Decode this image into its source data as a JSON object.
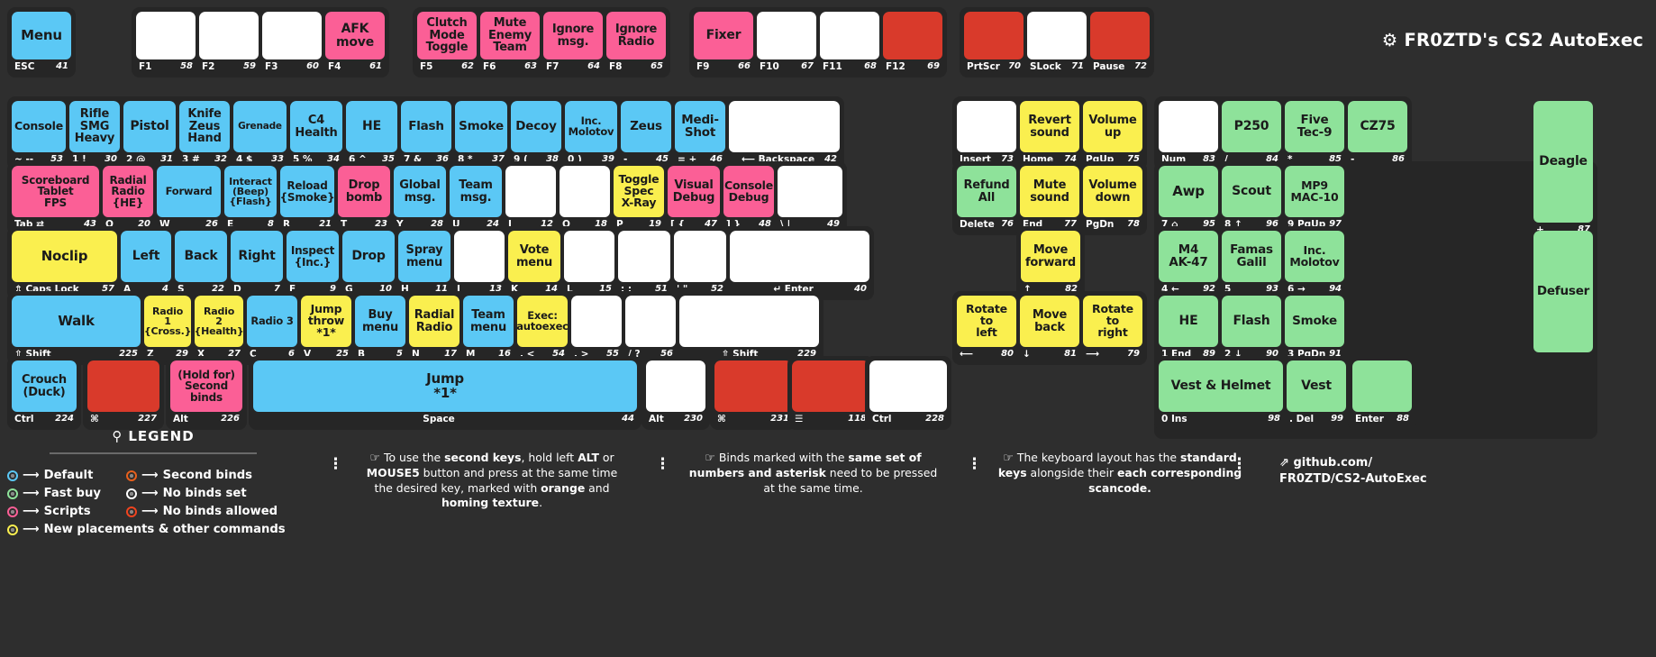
{
  "title": {
    "text": "FR0ZTD's CS2 AutoExec",
    "icon": "gear-icon"
  },
  "colors": {
    "background": "#2e2e2e",
    "block": "#262626",
    "default_blue": "#5bc8f5",
    "fast_buy_green": "#8ee29a",
    "scripts_pink": "#fb5f96",
    "second_binds_orange": "#e8601c",
    "no_binds_set_white": "#ffffff",
    "no_binds_allowed_red": "#d93a2b",
    "new_placements_yellow": "#faef4f"
  },
  "rows": {
    "function_row": [
      {
        "block": "esc",
        "keys": [
          {
            "cap": "Menu",
            "color": "c-blue",
            "name": "ESC",
            "sc": "41",
            "capsize": 15
          }
        ]
      },
      {
        "block": "f1-f4",
        "keys": [
          {
            "cap": "",
            "color": "c-white",
            "name": "F1",
            "sc": "58"
          },
          {
            "cap": "",
            "color": "c-white",
            "name": "F2",
            "sc": "59"
          },
          {
            "cap": "",
            "color": "c-white",
            "name": "F3",
            "sc": "60"
          },
          {
            "cap": "AFK\nmove",
            "color": "c-pink",
            "name": "F4",
            "sc": "61",
            "capsize": 14
          }
        ]
      },
      {
        "block": "f5-f8",
        "keys": [
          {
            "cap": "Clutch\nMode\nToggle",
            "color": "c-pink",
            "name": "F5",
            "sc": "62",
            "capsize": 13
          },
          {
            "cap": "Mute\nEnemy\nTeam",
            "color": "c-pink",
            "name": "F6",
            "sc": "63",
            "capsize": 13
          },
          {
            "cap": "Ignore\nmsg.",
            "color": "c-pink",
            "name": "F7",
            "sc": "64",
            "capsize": 13
          },
          {
            "cap": "Ignore\nRadio",
            "color": "c-pink",
            "name": "F8",
            "sc": "65",
            "capsize": 13
          }
        ]
      },
      {
        "block": "f9-f12",
        "keys": [
          {
            "cap": "Fixer",
            "color": "c-pink",
            "name": "F9",
            "sc": "66",
            "capsize": 14
          },
          {
            "cap": "",
            "color": "c-white",
            "name": "F10",
            "sc": "67"
          },
          {
            "cap": "",
            "color": "c-white",
            "name": "F11",
            "sc": "68"
          },
          {
            "cap": "",
            "color": "c-red",
            "name": "F12",
            "sc": "69"
          }
        ]
      },
      {
        "block": "prtscr",
        "keys": [
          {
            "cap": "",
            "color": "c-red",
            "name": "PrtScr",
            "sc": "70"
          },
          {
            "cap": "",
            "color": "c-white",
            "name": "SLock",
            "sc": "71"
          },
          {
            "cap": "",
            "color": "c-red",
            "name": "Pause",
            "sc": "72"
          }
        ]
      }
    ],
    "number_row": [
      {
        "cap": "Console",
        "color": "c-blue",
        "name": "~  --",
        "sc": "53",
        "capsize": 12.5
      },
      {
        "cap": "Rifle\nSMG\nHeavy",
        "color": "c-blue",
        "name": "1 !",
        "sc": "30",
        "capsize": 13
      },
      {
        "cap": "Pistol",
        "color": "c-blue",
        "name": "2 @",
        "sc": "31",
        "capsize": 14
      },
      {
        "cap": "Knife\nZeus\nHand",
        "color": "c-blue",
        "name": "3 #",
        "sc": "32",
        "capsize": 13
      },
      {
        "cap": "Grenade",
        "color": "c-blue",
        "name": "4 $",
        "sc": "33",
        "capsize": 10.5
      },
      {
        "cap": "C4\nHealth",
        "color": "c-blue",
        "name": "5 %",
        "sc": "34",
        "capsize": 13
      },
      {
        "cap": "HE",
        "color": "c-blue",
        "name": "6 ^",
        "sc": "35",
        "capsize": 14
      },
      {
        "cap": "Flash",
        "color": "c-blue",
        "name": "7 &",
        "sc": "36",
        "capsize": 13.5
      },
      {
        "cap": "Smoke",
        "color": "c-blue",
        "name": "8 *",
        "sc": "37",
        "capsize": 13.5
      },
      {
        "cap": "Decoy",
        "color": "c-blue",
        "name": "9 (",
        "sc": "38",
        "capsize": 13.5
      },
      {
        "cap": "Inc.\nMolotov",
        "color": "c-blue",
        "name": "0 )",
        "sc": "39",
        "capsize": 11.5
      },
      {
        "cap": "Zeus",
        "color": "c-blue",
        "name": "-  _",
        "sc": "45",
        "capsize": 13.5
      },
      {
        "cap": "Medi-\nShot",
        "color": "c-blue",
        "name": "= +",
        "sc": "46",
        "capsize": 13.5
      },
      {
        "cap": "",
        "color": "c-white",
        "name": "⟵ Backspace",
        "sc": "42",
        "wide": true
      }
    ],
    "number_row_right": [
      {
        "cap": "",
        "color": "c-white",
        "name": "Insert",
        "sc": "73"
      },
      {
        "cap": "Revert\nsound",
        "color": "c-yellow",
        "name": "Home",
        "sc": "74",
        "capsize": 13
      },
      {
        "cap": "Volume\nup",
        "color": "c-yellow",
        "name": "PgUp",
        "sc": "75",
        "capsize": 13
      }
    ],
    "number_row_numpad": [
      {
        "cap": "",
        "color": "c-white",
        "name": "Num",
        "sc": "83"
      },
      {
        "cap": "P250",
        "color": "c-green",
        "name": "/",
        "sc": "84",
        "capsize": 14
      },
      {
        "cap": "Five\nTec-9",
        "color": "c-green",
        "name": "*",
        "sc": "85",
        "capsize": 13.5
      },
      {
        "cap": "CZ75",
        "color": "c-green",
        "name": "-",
        "sc": "86",
        "capsize": 14
      }
    ],
    "qwerty_row": [
      {
        "cap": "Scoreboard\nTablet\nFPS",
        "color": "c-pink",
        "name": "Tab ⇄",
        "sc": "43",
        "capsize": 12
      },
      {
        "cap": "Radial\nRadio\n{HE}",
        "color": "c-pink",
        "name": "Q",
        "sc": "20",
        "capsize": 12,
        "second": "{HE}"
      },
      {
        "cap": "Forward",
        "color": "c-blue",
        "name": "W",
        "sc": "26",
        "capsize": 11.5
      },
      {
        "cap": "Interact\n(Beep)\n{Flash}",
        "color": "c-blue",
        "name": "E",
        "sc": "8",
        "capsize": 11
      },
      {
        "cap": "Reload\n{Smoke}",
        "color": "c-blue",
        "name": "R",
        "sc": "21",
        "capsize": 12
      },
      {
        "cap": "Drop\nbomb",
        "color": "c-pink",
        "name": "T",
        "sc": "23",
        "capsize": 13
      },
      {
        "cap": "Global\nmsg.",
        "color": "c-blue",
        "name": "Y",
        "sc": "28",
        "capsize": 13
      },
      {
        "cap": "Team\nmsg.",
        "color": "c-blue",
        "name": "U",
        "sc": "24",
        "capsize": 13
      },
      {
        "cap": "",
        "color": "c-white",
        "name": "I",
        "sc": "12"
      },
      {
        "cap": "",
        "color": "c-white",
        "name": "O",
        "sc": "18"
      },
      {
        "cap": "Toggle\nSpec\nX-Ray",
        "color": "c-yellow",
        "name": "P",
        "sc": "19",
        "capsize": 12.5
      },
      {
        "cap": "Visual\nDebug",
        "color": "c-pink",
        "name": "[ {",
        "sc": "47",
        "capsize": 13
      },
      {
        "cap": "Console\nDebug",
        "color": "c-pink",
        "name": "] }",
        "sc": "48",
        "capsize": 12.5
      },
      {
        "cap": "",
        "color": "c-white",
        "name": "\\ |",
        "sc": "49"
      }
    ],
    "qwerty_row_right": [
      {
        "cap": "Refund\nAll",
        "color": "c-green",
        "name": "Delete",
        "sc": "76",
        "capsize": 13
      },
      {
        "cap": "Mute\nsound",
        "color": "c-yellow",
        "name": "End",
        "sc": "77",
        "capsize": 13
      },
      {
        "cap": "Volume\ndown",
        "color": "c-yellow",
        "name": "PgDn",
        "sc": "78",
        "capsize": 13
      }
    ],
    "qwerty_row_numpad": [
      {
        "cap": "Awp",
        "color": "c-green",
        "name": "7 ⌂",
        "sc": "95",
        "capsize": 15
      },
      {
        "cap": "Scout",
        "color": "c-green",
        "name": "8 ↑",
        "sc": "96",
        "capsize": 14
      },
      {
        "cap": "MP9\nMAC-10",
        "color": "c-green",
        "name": "9 PgUp",
        "sc": "97",
        "capsize": 12.5
      },
      {
        "cap": "Deagle",
        "color": "c-green",
        "name": "+",
        "sc": "87",
        "capsize": 14,
        "tall": true
      }
    ],
    "home_row": [
      {
        "cap": "Noclip",
        "color": "c-yellow",
        "name": "⇬ Caps Lock",
        "sc": "57",
        "capsize": 15
      },
      {
        "cap": "Left",
        "color": "c-blue",
        "name": "A",
        "sc": "4",
        "capsize": 14
      },
      {
        "cap": "Back",
        "color": "c-blue",
        "name": "S",
        "sc": "22",
        "capsize": 14
      },
      {
        "cap": "Right",
        "color": "c-blue",
        "name": "D",
        "sc": "7",
        "capsize": 14
      },
      {
        "cap": "Inspect\n{Inc.}",
        "color": "c-blue",
        "name": "F",
        "sc": "9",
        "capsize": 12
      },
      {
        "cap": "Drop",
        "color": "c-blue",
        "name": "G",
        "sc": "10",
        "capsize": 14
      },
      {
        "cap": "Spray\nmenu",
        "color": "c-blue",
        "name": "H",
        "sc": "11",
        "capsize": 13
      },
      {
        "cap": "",
        "color": "c-white",
        "name": "J",
        "sc": "13"
      },
      {
        "cap": "Vote\nmenu",
        "color": "c-yellow",
        "name": "K",
        "sc": "14",
        "capsize": 13
      },
      {
        "cap": "",
        "color": "c-white",
        "name": "L",
        "sc": "15"
      },
      {
        "cap": "",
        "color": "c-white",
        "name": "; :",
        "sc": "51"
      },
      {
        "cap": "",
        "color": "c-white",
        "name": "' \"",
        "sc": "52"
      },
      {
        "cap": "",
        "color": "c-white",
        "name": "↵ Enter",
        "sc": "40",
        "wide": true
      }
    ],
    "home_row_right": [
      {
        "cap": "Move\nforward",
        "color": "c-yellow",
        "name": "↑",
        "sc": "82",
        "capsize": 13
      }
    ],
    "home_row_numpad": [
      {
        "cap": "M4\nAK-47",
        "color": "c-green",
        "name": "4 ←",
        "sc": "92",
        "capsize": 13.5
      },
      {
        "cap": "Famas\nGalil",
        "color": "c-green",
        "name": "5",
        "sc": "93",
        "capsize": 13.5
      },
      {
        "cap": "Inc.\nMolotov",
        "color": "c-green",
        "name": "6 →",
        "sc": "94",
        "capsize": 12.5
      }
    ],
    "shift_row": [
      {
        "cap": "Walk",
        "color": "c-blue",
        "name": "⇧ Shift",
        "sc": "225",
        "capsize": 15
      },
      {
        "cap": "Radio\n1\n{Cross.}",
        "color": "c-yellow",
        "name": "Z",
        "sc": "29",
        "capsize": 11
      },
      {
        "cap": "Radio\n2\n{Health}",
        "color": "c-yellow",
        "name": "X",
        "sc": "27",
        "capsize": 11
      },
      {
        "cap": "Radio 3",
        "color": "c-blue",
        "name": "C",
        "sc": "6",
        "capsize": 11.5
      },
      {
        "cap": "Jump\nthrow\n*1*",
        "color": "c-yellow",
        "name": "V",
        "sc": "25",
        "capsize": 12.5
      },
      {
        "cap": "Buy\nmenu",
        "color": "c-blue",
        "name": "B",
        "sc": "5",
        "capsize": 13
      },
      {
        "cap": "Radial\nRadio",
        "color": "c-yellow",
        "name": "N",
        "sc": "17",
        "capsize": 13
      },
      {
        "cap": "Team\nmenu",
        "color": "c-blue",
        "name": "M",
        "sc": "16",
        "capsize": 13
      },
      {
        "cap": "Exec:\nautoexec",
        "color": "c-yellow",
        "name": ", <",
        "sc": "54",
        "capsize": 11.5
      },
      {
        "cap": "",
        "color": "c-white",
        "name": ". >",
        "sc": "55"
      },
      {
        "cap": "",
        "color": "c-white",
        "name": "/ ?",
        "sc": "56"
      },
      {
        "cap": "",
        "color": "c-white",
        "name": "⇧ Shift",
        "sc": "229",
        "wide": true
      }
    ],
    "shift_row_right": [
      {
        "cap": "Rotate\nto\nleft",
        "color": "c-yellow",
        "name": "⟵",
        "sc": "80",
        "capsize": 12.5
      },
      {
        "cap": "Move\nback",
        "color": "c-yellow",
        "name": "↓",
        "sc": "81",
        "capsize": 13
      },
      {
        "cap": "Rotate\nto\nright",
        "color": "c-yellow",
        "name": "⟶",
        "sc": "79",
        "capsize": 12.5
      }
    ],
    "shift_row_numpad": [
      {
        "cap": "HE",
        "color": "c-green",
        "name": "1 End",
        "sc": "89",
        "capsize": 14
      },
      {
        "cap": "Flash",
        "color": "c-green",
        "name": "2 ↓",
        "sc": "90",
        "capsize": 14
      },
      {
        "cap": "Smoke",
        "color": "c-green",
        "name": "3 PgDn",
        "sc": "91",
        "capsize": 13.5
      },
      {
        "cap": "Defuser",
        "color": "c-green",
        "name": "",
        "sc": "",
        "capsize": 13.5,
        "tall": true
      }
    ],
    "space_row": [
      {
        "cap": "Crouch\n(Duck)",
        "color": "c-blue",
        "name": "Ctrl",
        "sc": "224",
        "capsize": 13
      },
      {
        "cap": "",
        "color": "c-red",
        "name": "⌘",
        "sc": "227"
      },
      {
        "cap": "(Hold for)\nSecond\nbinds",
        "color": "c-pink",
        "name": "Alt",
        "sc": "226",
        "capsize": 12
      },
      {
        "cap": "Jump\n*1*",
        "color": "c-blue",
        "name": "Space",
        "sc": "44",
        "capsize": 15,
        "wide": true
      },
      {
        "cap": "",
        "color": "c-white",
        "name": "Alt",
        "sc": "230"
      },
      {
        "cap": "",
        "color": "c-red",
        "name": "⌘",
        "sc": "231"
      },
      {
        "cap": "",
        "color": "c-red",
        "name": "☰",
        "sc": "118"
      },
      {
        "cap": "",
        "color": "c-white",
        "name": "Ctrl",
        "sc": "228"
      }
    ],
    "space_row_numpad": [
      {
        "cap": "Vest & Helmet",
        "color": "c-green",
        "name": "0 Ins",
        "sc": "98",
        "capsize": 14
      },
      {
        "cap": "Vest",
        "color": "c-green",
        "name": ". Del",
        "sc": "99",
        "capsize": 14
      },
      {
        "cap": "",
        "color": "c-green",
        "name": "Enter",
        "sc": "88"
      }
    ]
  },
  "legend": {
    "heading": "LEGEND",
    "icon": "signpost-icon",
    "items": [
      {
        "color": "#5bc8f5",
        "label": "Default"
      },
      {
        "color": "#e8601c",
        "label": "Second binds"
      },
      {
        "color": "#8ee29a",
        "label": "Fast buy"
      },
      {
        "color": "#ffffff",
        "label": "No binds set"
      },
      {
        "color": "#fb5f96",
        "label": "Scripts"
      },
      {
        "color": "#f0441f",
        "label": "No binds allowed"
      },
      {
        "color": "#faef4f",
        "label": "New placements & other commands"
      }
    ]
  },
  "notes": [
    {
      "icon": "hand-pointer-icon",
      "html": "To use the <b>second keys</b>, hold left <b>ALT</b> or <b>MOUSE5</b> button and press at the same time the desired key, marked with <b>orange</b> and <b>homing texture</b>."
    },
    {
      "icon": "hand-pointer-icon",
      "html": "Binds marked with the <b>same set of numbers and asterisk</b> need to be pressed at the same time."
    },
    {
      "icon": "hand-pointer-icon",
      "html": "The keyboard layout has the <b>standard keys</b> alongside their <b>each corresponding scancode.</b>"
    }
  ],
  "github": {
    "icon": "external-link-icon",
    "line1": "github.com/",
    "line2": "FR0ZTD/CS2-AutoExec"
  }
}
